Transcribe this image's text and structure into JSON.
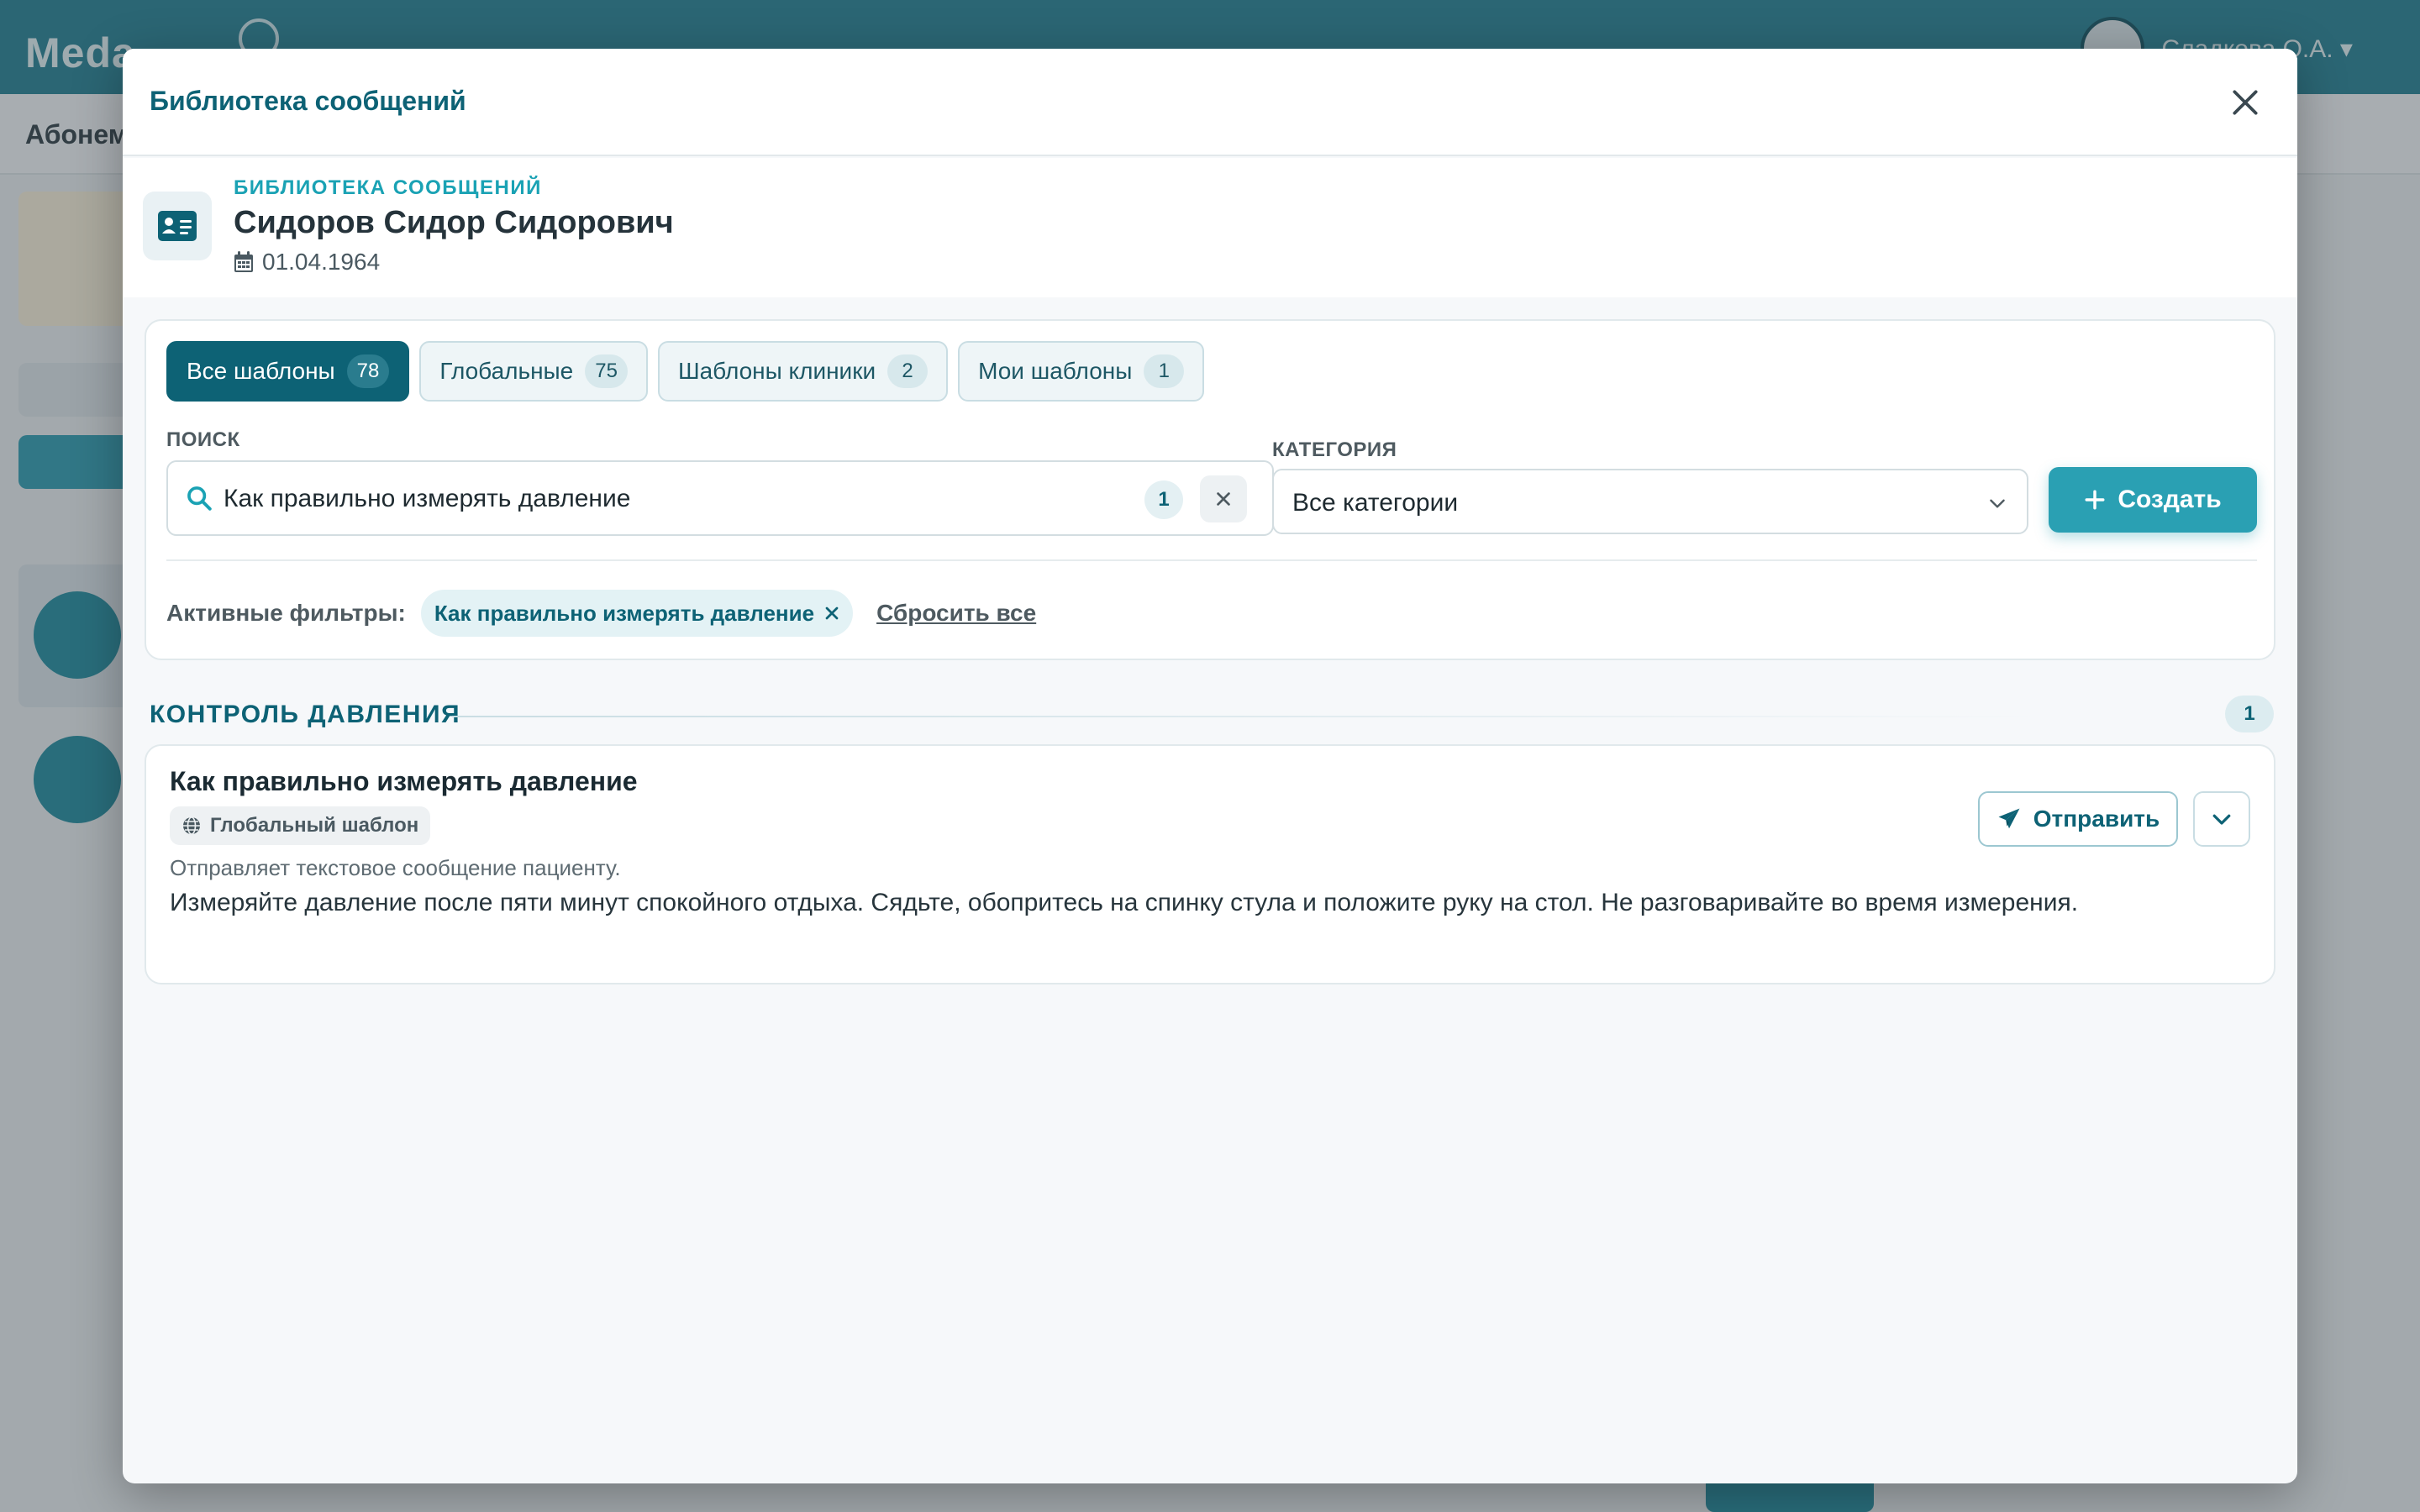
{
  "background": {
    "app_name": "Meda",
    "user_name": "Сладкова О.А. ▾",
    "sub_label": "Абонем"
  },
  "modal": {
    "title": "Библиотека сообщений"
  },
  "patient": {
    "kicker": "БИБЛИОТЕКА СООБЩЕНИЙ",
    "name": "Сидоров Сидор Сидорович",
    "birth_date": "01.04.1964"
  },
  "tabs": [
    {
      "label": "Все шаблоны",
      "count": "78",
      "active": true
    },
    {
      "label": "Глобальные",
      "count": "75",
      "active": false
    },
    {
      "label": "Шаблоны клиники",
      "count": "2",
      "active": false
    },
    {
      "label": "Мои шаблоны",
      "count": "1",
      "active": false
    }
  ],
  "search": {
    "label": "ПОИСК",
    "value": "Как правильно измерять давление",
    "result_count": "1"
  },
  "category": {
    "label": "КАТЕГОРИЯ",
    "selected": "Все категории"
  },
  "create_button": {
    "label": "Создать"
  },
  "filters": {
    "label": "Активные фильтры:",
    "chips": [
      "Как правильно измерять давление"
    ],
    "reset_label": "Сбросить все"
  },
  "groups": [
    {
      "title": "КОНТРОЛЬ ДАВЛЕНИЯ",
      "count": "1",
      "templates": [
        {
          "title": "Как правильно измерять давление",
          "badge": "Глобальный шаблон",
          "description": "Отправляет текстовое сообщение пациенту.",
          "body": "Измеряйте давление после пяти минут спокойного отдыха. Сядьте, обопритесь на спинку стула и положите руку на стол. Не разговаривайте во время измерения.",
          "send_label": "Отправить"
        }
      ]
    }
  ],
  "colors": {
    "primary_dark": "#0d6275",
    "accent": "#2aa0b3",
    "kicker": "#1aa2b4",
    "topbar": "#1f7f91"
  },
  "icons": {
    "close": "close-icon",
    "patient": "id-card-icon",
    "calendar": "calendar-icon",
    "search": "search-icon",
    "clear": "close-icon",
    "select": "chevron-down-icon",
    "create": "plus-icon",
    "chip_remove": "close-icon",
    "badge": "globe-icon",
    "send": "paper-plane-icon",
    "expand": "chevron-down-icon"
  }
}
